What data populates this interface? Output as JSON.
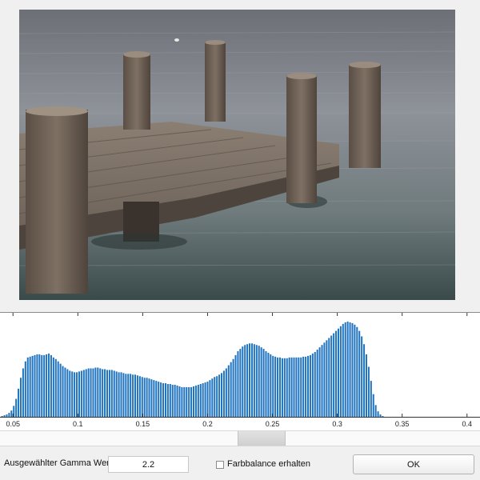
{
  "image": {
    "alt_icon": "photo-wooden-pier"
  },
  "histogram": {
    "x_ticks": [
      "0.05",
      "0.1",
      "0.15",
      "0.2",
      "0.25",
      "0.3",
      "0.35",
      "0.4"
    ],
    "bar_color": "#1f73bf"
  },
  "chart_data": {
    "type": "bar",
    "xlim": [
      0.04,
      0.41
    ],
    "x_start": 0.041,
    "bin_width": 0.0018,
    "values": [
      1,
      2,
      3,
      5,
      8,
      14,
      23,
      36,
      50,
      62,
      71,
      76,
      77,
      78,
      79,
      80,
      80,
      79,
      79,
      80,
      81,
      79,
      76,
      74,
      71,
      68,
      65,
      63,
      61,
      59,
      58,
      57,
      57,
      58,
      59,
      60,
      61,
      62,
      62,
      62,
      63,
      63,
      62,
      61,
      61,
      60,
      60,
      60,
      59,
      58,
      57,
      57,
      56,
      55,
      55,
      55,
      54,
      54,
      53,
      52,
      51,
      50,
      50,
      49,
      48,
      47,
      46,
      45,
      44,
      43,
      43,
      42,
      42,
      41,
      41,
      40,
      39,
      38,
      38,
      38,
      38,
      38,
      39,
      40,
      41,
      42,
      43,
      44,
      45,
      47,
      49,
      51,
      52,
      54,
      56,
      59,
      62,
      66,
      70,
      74,
      79,
      84,
      87,
      90,
      92,
      93,
      94,
      94,
      93,
      92,
      91,
      89,
      87,
      84,
      82,
      80,
      78,
      77,
      76,
      76,
      75,
      75,
      75,
      76,
      76,
      76,
      76,
      76,
      76,
      77,
      77,
      78,
      79,
      81,
      83,
      86,
      89,
      92,
      95,
      98,
      101,
      104,
      107,
      110,
      113,
      116,
      119,
      121,
      122,
      121,
      120,
      118,
      115,
      110,
      103,
      93,
      80,
      64,
      46,
      29,
      15,
      7,
      3,
      1
    ],
    "ylim": [
      0,
      125
    ]
  },
  "controls": {
    "gamma_label": "Ausgewählter Gamma Wert",
    "gamma_value": "2.2",
    "colorbalance_label": "Farbbalance erhalten",
    "colorbalance_checked": false,
    "ok_label": "OK"
  },
  "colors": {
    "panel_bg": "#f0f0f0",
    "histogram_bg": "#ffffff",
    "bar": "#1f73bf"
  }
}
